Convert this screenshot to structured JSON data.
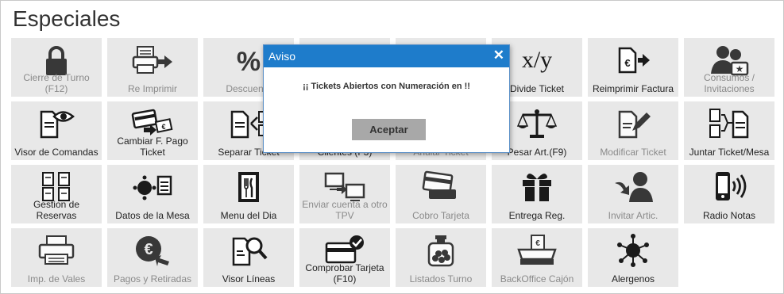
{
  "header": {
    "title": "Especiales"
  },
  "tiles": [
    {
      "name": "cierre-turno",
      "icon": "lock-icon",
      "label": "Cierre  de  Turno (F12)",
      "enabled": false
    },
    {
      "name": "re-imprimir",
      "icon": "printer-arrow-icon",
      "label": "Re Imprimir",
      "enabled": false
    },
    {
      "name": "descuento",
      "icon": "percent-icon",
      "label": "Descuento",
      "enabled": false
    },
    {
      "name": "tile-hidden-1",
      "icon": "document-icon",
      "label": "",
      "enabled": false
    },
    {
      "name": "tile-hidden-2",
      "icon": "document-icon",
      "label": "",
      "enabled": false
    },
    {
      "name": "divide-ticket",
      "icon": "x-over-y-icon",
      "label": "Divide Ticket",
      "enabled": true
    },
    {
      "name": "reimprimir-factura",
      "icon": "euro-document-arrow-icon",
      "label": "Reimprimir Factura",
      "enabled": true
    },
    {
      "name": "consumos-invitaciones",
      "icon": "people-star-icon",
      "label": "Consumos  / Invitaciones",
      "enabled": false
    },
    {
      "name": "visor-comandas",
      "icon": "document-eye-icon",
      "label": "Visor de Comandas",
      "enabled": true
    },
    {
      "name": "cambiar-f-pago",
      "icon": "card-cash-icon",
      "label": "Cambiar F. Pago Ticket",
      "enabled": true
    },
    {
      "name": "separar-ticket",
      "icon": "document-split-icon",
      "label": "Separar Ticket",
      "enabled": true
    },
    {
      "name": "clientes",
      "icon": "person-icon",
      "label": "Clientes (F3)",
      "enabled": true
    },
    {
      "name": "anular-ticket",
      "icon": "document-x-icon",
      "label": "Anular Ticket",
      "enabled": false
    },
    {
      "name": "pesar-art",
      "icon": "scale-icon",
      "label": "Pesar Art.(F9)",
      "enabled": true
    },
    {
      "name": "modificar-ticket",
      "icon": "document-pencil-icon",
      "label": "Modificar Ticket",
      "enabled": false
    },
    {
      "name": "juntar-ticket-mesa",
      "icon": "documents-merge-icon",
      "label": "Juntar  Ticket/Mesa",
      "enabled": true
    },
    {
      "name": "gestion-reservas",
      "icon": "documents-stack-icon",
      "label": "Gestion de Reservas",
      "enabled": true
    },
    {
      "name": "datos-mesa",
      "icon": "table-dots-icon",
      "label": "Datos de la Mesa",
      "enabled": true
    },
    {
      "name": "menu-dia",
      "icon": "cutlery-menu-icon",
      "label": "Menu del Dia",
      "enabled": true
    },
    {
      "name": "enviar-cuenta-tpv",
      "icon": "screens-transfer-icon",
      "label": "Enviar cuenta a otro TPV",
      "enabled": false
    },
    {
      "name": "cobro-tarjeta",
      "icon": "card-reader-icon",
      "label": "Cobro Tarjeta",
      "enabled": false
    },
    {
      "name": "entrega-reg",
      "icon": "gift-icon",
      "label": "Entrega Reg.",
      "enabled": true
    },
    {
      "name": "invitar-artic",
      "icon": "person-arrow-icon",
      "label": "Invitar Artic.",
      "enabled": false
    },
    {
      "name": "radio-notas",
      "icon": "phone-signal-icon",
      "label": "Radio Notas",
      "enabled": true
    },
    {
      "name": "imp-vales",
      "icon": "printer-icon",
      "label": "Imp. de Vales",
      "enabled": false
    },
    {
      "name": "pagos-retiradas",
      "icon": "euro-arrow-icon",
      "label": "Pagos y Retiradas",
      "enabled": false
    },
    {
      "name": "visor-lineas",
      "icon": "document-magnifier-icon",
      "label": "Visor Líneas",
      "enabled": true
    },
    {
      "name": "comprobar-tarjeta",
      "icon": "card-check-icon",
      "label": "Comprobar Tarjeta (F10)",
      "enabled": true
    },
    {
      "name": "listados-turno",
      "icon": "jar-icon",
      "label": "Listados Turno",
      "enabled": false
    },
    {
      "name": "backoffice-cajon",
      "icon": "cash-drawer-icon",
      "label": "BackOffice Cajón",
      "enabled": false
    },
    {
      "name": "alergenos",
      "icon": "molecule-icon",
      "label": "Alergenos",
      "enabled": true
    }
  ],
  "dialog": {
    "title": "Aviso",
    "close_glyph": "✕",
    "message": "¡¡ Tickets Abiertos con Numeración en  !!",
    "ok_label": "Aceptar",
    "header_color": "#1e7ccb"
  },
  "colors": {
    "tile_bg": "#e8e8e8",
    "icon_color": "#1a1a1a",
    "label_enabled": "#222222",
    "label_disabled": "#8a8a8a"
  }
}
